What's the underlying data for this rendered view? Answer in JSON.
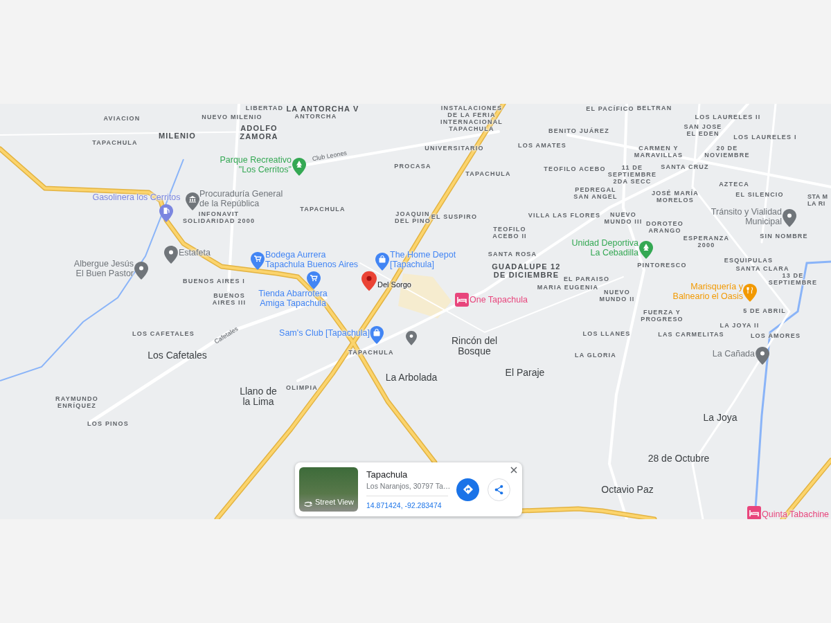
{
  "map": {
    "area_labels": [
      "LIBERTAD",
      "LA ANTORCHA V",
      "AVIACION",
      "NUEVO MILENIO",
      "ANTORCHA",
      "MILENIO",
      "ADOLFO\nZAMORA",
      "TAPACHULA",
      "INSTALACIONES\nDE LA FERIA\nINTERNACIONAL\nTAPACHULA",
      "UNIVERSITARIO",
      "PROCASA",
      "TAPACHULA",
      "TAPACHULA",
      "INFONAVIT\nSOLIDARIDAD 2000",
      "JOAQUIN\nDEL PINO",
      "EL SUSPIRO",
      "TEOFILO\nACEBO II",
      "SANTA ROSA",
      "GUADALUPE 12\nDE DICIEMBRE",
      "VILLA LAS FLORES",
      "BUENOS AIRES I",
      "BUENOS\nAIRES III",
      "EL PACÍFICO",
      "BELTRAN",
      "LOS LAURELES II",
      "BENITO JUÁREZ",
      "SAN JOSE\nEL EDEN",
      "LOS LAURELES I",
      "LOS AMATES",
      "CARMEN Y\nMARAVILLAS",
      "20 DE\nNOVIEMBRE",
      "TEOFILO ACEBO",
      "11 DE\nSEPTIEMBRE\n2DA SECC",
      "SANTA CRUZ",
      "AZTECA",
      "PEDREGAL\nSAN ANGEL",
      "JOSÉ MARÍA\nMORELOS",
      "EL SILENCIO",
      "STA M\nLA RI",
      "NUEVO\nMUNDO III",
      "DOROTEO\nARANGO",
      "SIN NOMBRE",
      "ESPERANZA\n2000",
      "PINTORESCO",
      "ESQUIPULAS",
      "SANTA CLARA",
      "EL PARAISO",
      "13 DE\nSEPTIEMBRE",
      "MARIA EUGENIA",
      "NUEVO\nMUNDO II",
      "FUERZA Y\nPROGRESO",
      "5 DE ABRIL",
      "LA JOYA II",
      "LOS LLANES",
      "LAS CARMELITAS",
      "LOS AMORES",
      "LA GLORIA",
      "LOS CAFETALES",
      "RAYMUNDO\nENRÍQUEZ",
      "LOS PINOS",
      "TAPACHULA",
      "OLIMPIA"
    ],
    "place_labels": [
      "Los Cafetales",
      "Llano de\nla Lima",
      "Rincón del\nBosque",
      "La Arbolada",
      "El Paraje",
      "La Joya",
      "28 de Octubre",
      "Octavio Paz"
    ],
    "road_labels": [
      "Club Leones",
      "Cafetales"
    ],
    "places_of_interest": [
      {
        "name": "Parque Recreativo\n\"Los Cerritos\"",
        "kind": "park",
        "color": "#34a853"
      },
      {
        "name": "Gasolinera los Cerritos",
        "kind": "gas",
        "color": "#7b86e0"
      },
      {
        "name": "Procuraduría General\nde la República",
        "kind": "government",
        "color": "#70757a"
      },
      {
        "name": "Estafeta",
        "kind": "place",
        "color": "#70757a"
      },
      {
        "name": "Albergue Jesús\nEl Buen Pastor",
        "kind": "place",
        "color": "#70757a"
      },
      {
        "name": "Bodega Aurrera\nTapachula Buenos Aires",
        "kind": "cart",
        "color": "#4285f4"
      },
      {
        "name": "Tienda Abarrotera\nAmiga Tapachula",
        "kind": "cart",
        "color": "#4285f4"
      },
      {
        "name": "The Home Depot\n[Tapachula]",
        "kind": "bag",
        "color": "#4285f4"
      },
      {
        "name": "Sam's Club [Tapachula]",
        "kind": "bag",
        "color": "#4285f4"
      },
      {
        "name": "One Tapachula",
        "kind": "lodging",
        "color": "#e8457c"
      },
      {
        "name": "Unidad Deportiva\nLa Cebadilla",
        "kind": "park",
        "color": "#34a853"
      },
      {
        "name": "Tránsito y Vialidad\nMunicipal",
        "kind": "place",
        "color": "#70757a"
      },
      {
        "name": "Marisquería y\nBalneario el Oasis",
        "kind": "food",
        "color": "#f29900"
      },
      {
        "name": "La Cañada",
        "kind": "place",
        "color": "#70757a"
      },
      {
        "name": "Quinta Tabachine",
        "kind": "lodging",
        "color": "#e8457c"
      }
    ],
    "dropped_pin": {
      "label": "Del Sorgo"
    }
  },
  "info_card": {
    "thumbnail_label": "Street View",
    "title": "Tapachula",
    "address": "Los Naranjos, 30797 Ta…",
    "coordinates": "14.871424, -92.283474"
  }
}
